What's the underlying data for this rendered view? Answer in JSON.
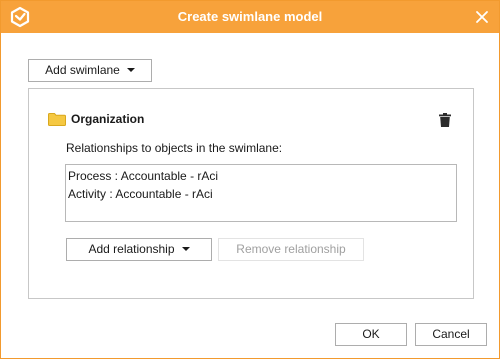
{
  "window": {
    "title": "Create swimlane model",
    "app_icon": "app-logo-icon",
    "close_icon": "close-icon",
    "accent_color": "#f7a23b"
  },
  "toolbar": {
    "add_swimlane_label": "Add swimlane"
  },
  "swimlane": {
    "name": "Organization",
    "folder_icon": "folder-icon",
    "folder_color": "#f5c842",
    "delete_icon": "trash-icon",
    "relationships_label": "Relationships to objects in the swimlane:",
    "relationships": [
      {
        "text": "Process : Accountable - rAci"
      },
      {
        "text": "Activity : Accountable - rAci"
      }
    ],
    "add_relationship_label": "Add relationship",
    "remove_relationship_label": "Remove relationship",
    "remove_relationship_enabled": false
  },
  "footer": {
    "ok_label": "OK",
    "cancel_label": "Cancel"
  }
}
